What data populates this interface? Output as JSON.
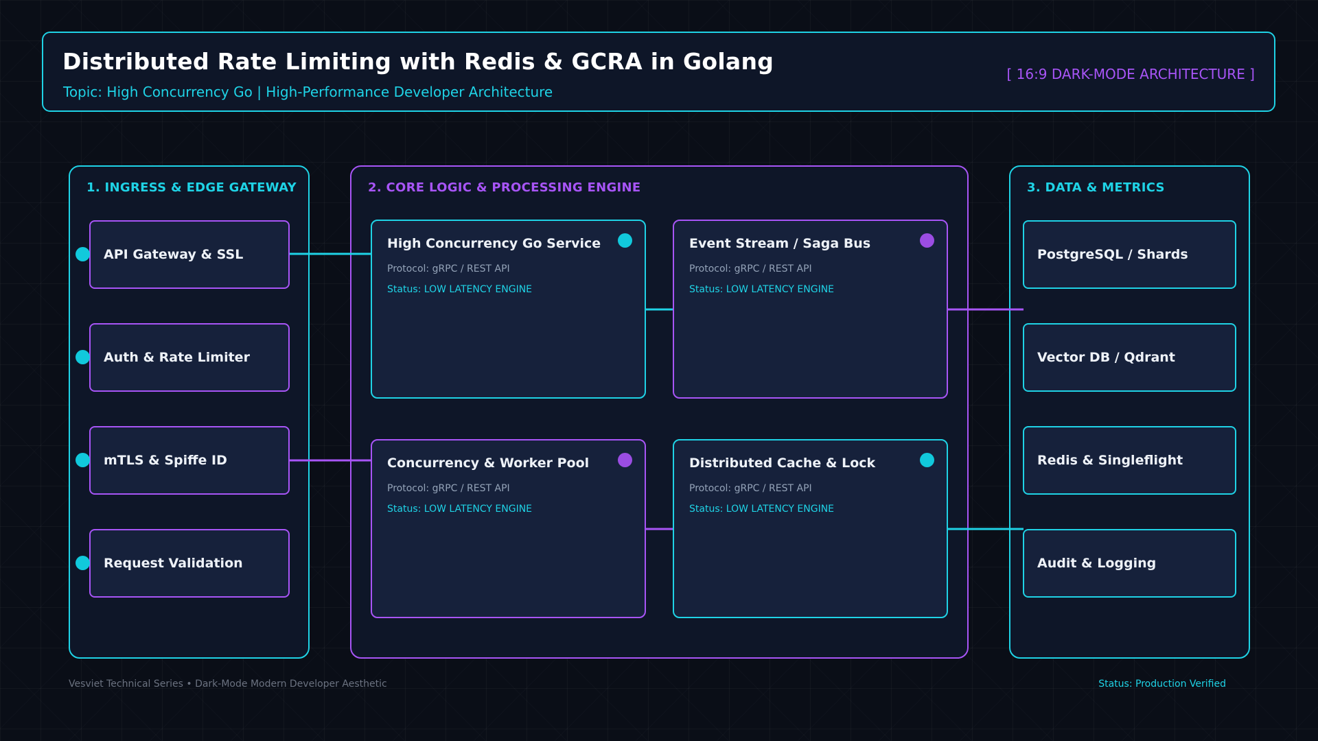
{
  "header": {
    "title": "Distributed Rate Limiting with Redis & GCRA in Golang",
    "subtitle": "Topic: High Concurrency Go | High-Performance Developer Architecture",
    "tag": "[ 16:9 DARK-MODE ARCHITECTURE ]"
  },
  "panels": {
    "ingress": {
      "title": "1. INGRESS & EDGE GATEWAY",
      "items": [
        "API Gateway & SSL",
        "Auth & Rate Limiter",
        "mTLS & Spiffe ID",
        "Request Validation"
      ]
    },
    "core": {
      "title": "2. CORE LOGIC & PROCESSING ENGINE",
      "cards": [
        {
          "name": "High Concurrency Go Service",
          "protocol": "Protocol: gRPC / REST API",
          "status": "Status: LOW LATENCY ENGINE"
        },
        {
          "name": "Event Stream / Saga Bus",
          "protocol": "Protocol: gRPC / REST API",
          "status": "Status: LOW LATENCY ENGINE"
        },
        {
          "name": "Concurrency & Worker Pool",
          "protocol": "Protocol: gRPC / REST API",
          "status": "Status: LOW LATENCY ENGINE"
        },
        {
          "name": "Distributed Cache & Lock",
          "protocol": "Protocol: gRPC / REST API",
          "status": "Status: LOW LATENCY ENGINE"
        }
      ]
    },
    "data": {
      "title": "3. DATA & METRICS",
      "items": [
        "PostgreSQL / Shards",
        "Vector DB / Qdrant",
        "Redis & Singleflight",
        "Audit & Logging"
      ]
    }
  },
  "footer": {
    "left": "Vesviet Technical Series • Dark-Mode Modern Developer Aesthetic",
    "right": "Status: Production Verified"
  },
  "colors": {
    "background": "#0a0e17",
    "cyan": "#1fd3e6",
    "purple": "#a855f7",
    "box_fill": "#16213b",
    "panel_fill": "#0e1628"
  }
}
